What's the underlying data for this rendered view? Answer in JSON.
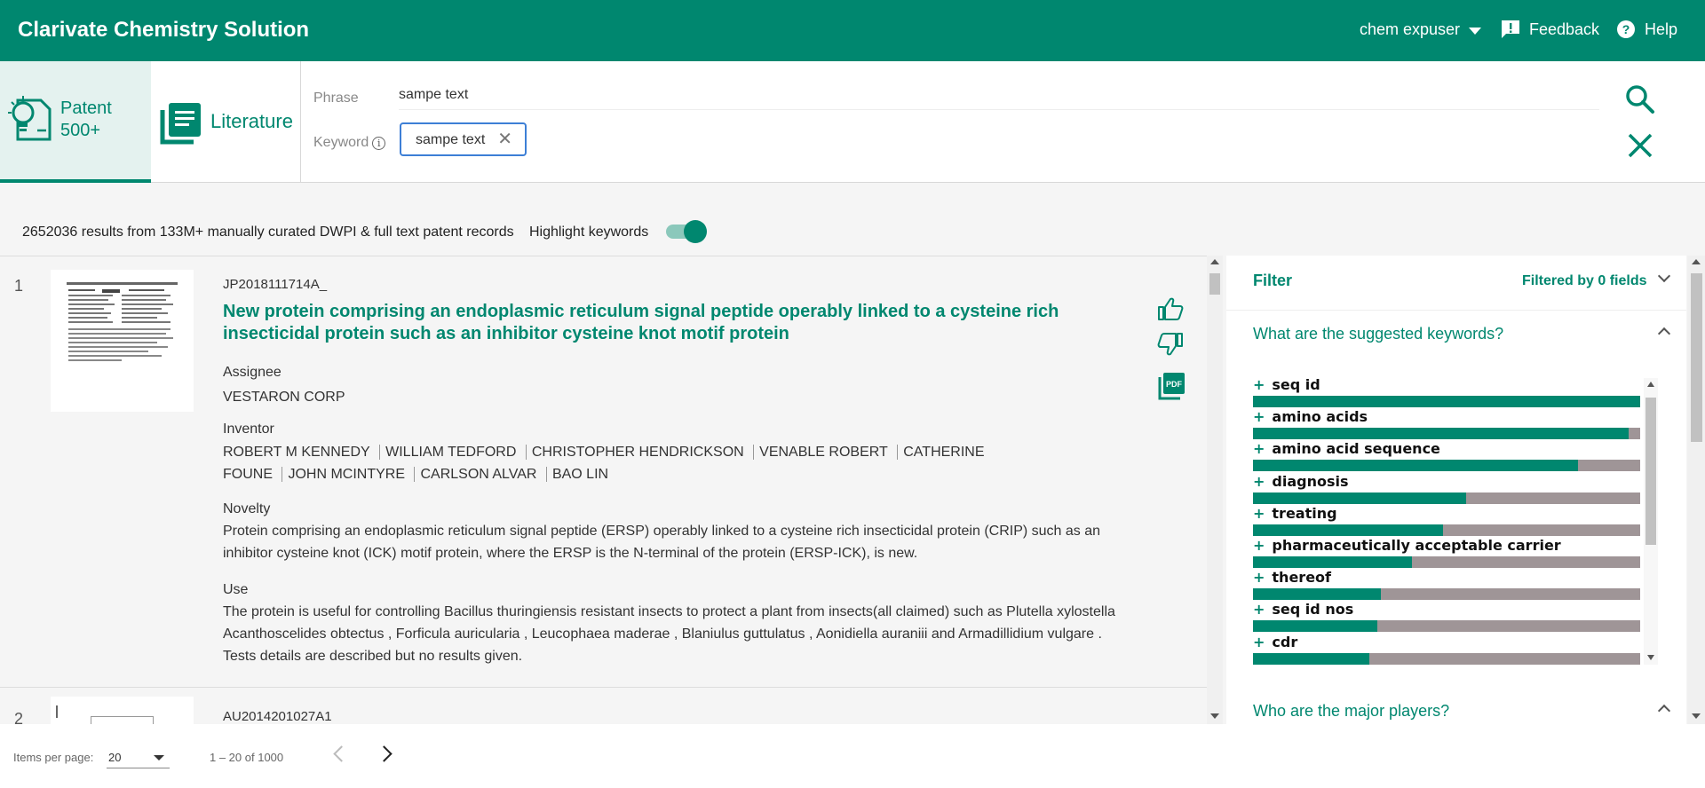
{
  "header": {
    "app_title": "Clarivate Chemistry Solution",
    "user": "chem expuser",
    "feedback": "Feedback",
    "help": "Help"
  },
  "search": {
    "tabs": {
      "patent": "Patent",
      "patent_count": "500+",
      "literature": "Literature"
    },
    "phrase_label": "Phrase",
    "phrase_value": "sampe text",
    "keyword_label": "Keyword",
    "keyword_chip": "sampe text",
    "info_glyph": "i",
    "chip_close_glyph": "✕"
  },
  "summary": {
    "results_text": "2652036 results from 133M+ manually curated DWPI & full text patent records",
    "highlight_label": "Highlight keywords",
    "highlight_on": true
  },
  "results": [
    {
      "rank": "1",
      "id": "JP2018111714A_",
      "title": "New protein comprising an endoplasmic reticulum signal peptide operably linked to a cysteine rich insecticidal protein such as an inhibitor cysteine knot motif protein",
      "assignee_label": "Assignee",
      "assignee": "VESTARON CORP",
      "inventor_label": "Inventor",
      "inventors": [
        "ROBERT M KENNEDY",
        "WILLIAM TEDFORD",
        "CHRISTOPHER HENDRICKSON",
        "VENABLE ROBERT",
        "CATHERINE FOUNE",
        "JOHN MCINTYRE",
        "CARLSON ALVAR",
        "BAO LIN"
      ],
      "novelty_label": "Novelty",
      "novelty": "Protein comprising an endoplasmic reticulum signal peptide (ERSP) operably linked to a cysteine rich insecticidal protein (CRIP) such as an inhibitor cysteine knot (ICK) motif protein, where the ERSP is the N-terminal of the protein (ERSP-ICK), is new.",
      "use_label": "Use",
      "use": "The protein is useful for controlling Bacillus thuringiensis resistant insects to protect a plant from insects(all claimed) such as Plutella xylostella Acanthoscelides obtectus , Forficula auricularia , Leucophaea maderae , Blaniulus guttulatus , Aonidiella auraniii and Armadillidium vulgare . Tests details are described but no results given."
    },
    {
      "rank": "2",
      "id": "AU2014201027A1"
    }
  ],
  "filter": {
    "title": "Filter",
    "filtered_by": "Filtered by 0 fields",
    "q_keywords": "What are the suggested keywords?",
    "q_players": "Who are the major players?",
    "plus_glyph": "+",
    "keywords": [
      {
        "label": "seq id",
        "value": 1.0
      },
      {
        "label": "amino acids",
        "value": 0.97
      },
      {
        "label": "amino acid sequence",
        "value": 0.84
      },
      {
        "label": "diagnosis",
        "value": 0.55
      },
      {
        "label": "treating",
        "value": 0.49
      },
      {
        "label": "pharmaceutically acceptable carrier",
        "value": 0.41
      },
      {
        "label": "thereof",
        "value": 0.33
      },
      {
        "label": "seq id nos",
        "value": 0.32
      },
      {
        "label": "cdr",
        "value": 0.3
      }
    ],
    "colors": {
      "fill": "#00876f",
      "remainder": "#9f9597"
    }
  },
  "pager": {
    "items_per_page_label": "Items per page:",
    "items_per_page": "20",
    "range": "1 – 20 of 1000"
  },
  "colors": {
    "brand": "#00876f",
    "chip_border": "#3d7fd6"
  },
  "icons": [
    "user-caret-icon",
    "feedback-icon",
    "help-icon",
    "patent-bulb-icon",
    "literature-book-icon",
    "info-icon",
    "chip-close-icon",
    "search-icon",
    "clear-icon",
    "thumbs-up-icon",
    "thumbs-down-icon",
    "pdf-icon",
    "prev-page-icon",
    "next-page-icon"
  ]
}
